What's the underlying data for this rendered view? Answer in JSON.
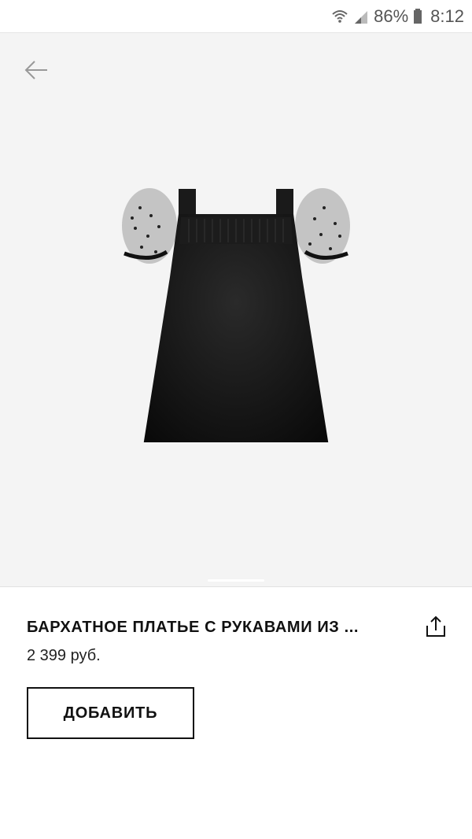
{
  "status_bar": {
    "icons": [
      "wifi-icon",
      "signal-icon",
      "battery-icon"
    ],
    "battery_percent": "86%",
    "time": "8:12"
  },
  "product": {
    "image_icon": "black-velvet-dress-photo",
    "title": "БАРХАТНОЕ ПЛАТЬЕ С РУКАВАМИ ИЗ ...",
    "price": "2 399 руб."
  },
  "actions": {
    "back_icon": "arrow-left-icon",
    "share_icon": "share-icon",
    "add_label": "ДОБАВИТЬ"
  }
}
